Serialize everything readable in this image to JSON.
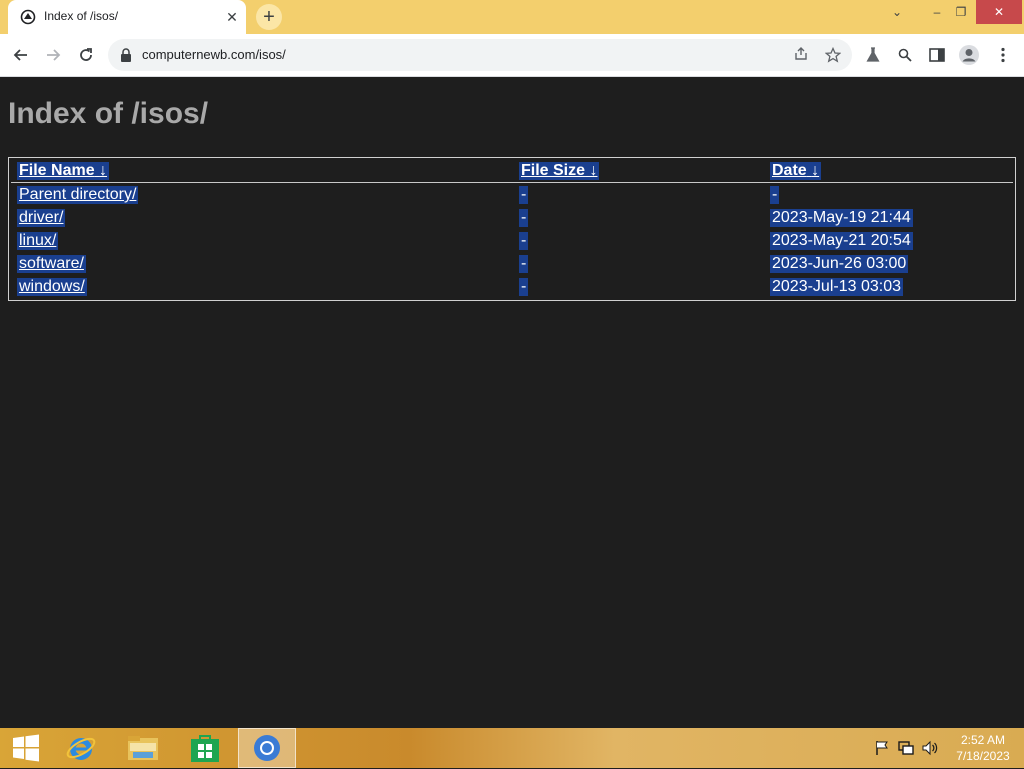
{
  "browser": {
    "tab_title": "Index of /isos/",
    "tab_close": "✕",
    "new_tab": "+",
    "url": "computernewb.com/isos/",
    "window_controls": {
      "chevron": "⌄",
      "minimize": "–",
      "restore": "❐",
      "close": "✕"
    }
  },
  "page": {
    "heading": "Index of /isos/",
    "columns": [
      {
        "label": "File Name",
        "sort_arrow": "↓"
      },
      {
        "label": "File Size",
        "sort_arrow": "↓"
      },
      {
        "label": "Date",
        "sort_arrow": "↓"
      }
    ],
    "rows": [
      {
        "name": "Parent directory/",
        "size": "-",
        "date": "-"
      },
      {
        "name": "driver/",
        "size": "-",
        "date": "2023-May-19 21:44"
      },
      {
        "name": "linux/",
        "size": "-",
        "date": "2023-May-21 20:54"
      },
      {
        "name": "software/",
        "size": "-",
        "date": "2023-Jun-26 03:00"
      },
      {
        "name": "windows/",
        "size": "-",
        "date": "2023-Jul-13 03:03"
      }
    ]
  },
  "taskbar": {
    "apps": [
      "start-icon",
      "internet-explorer-icon",
      "file-explorer-icon",
      "store-icon",
      "chrome-icon"
    ],
    "clock_time": "2:52 AM",
    "clock_date": "7/18/2023"
  },
  "colors": {
    "page_bg": "#1e1e1e",
    "selection": "#1a3f8f",
    "heading": "#a9a9a9",
    "tabstrip": "#f3cf6d"
  }
}
